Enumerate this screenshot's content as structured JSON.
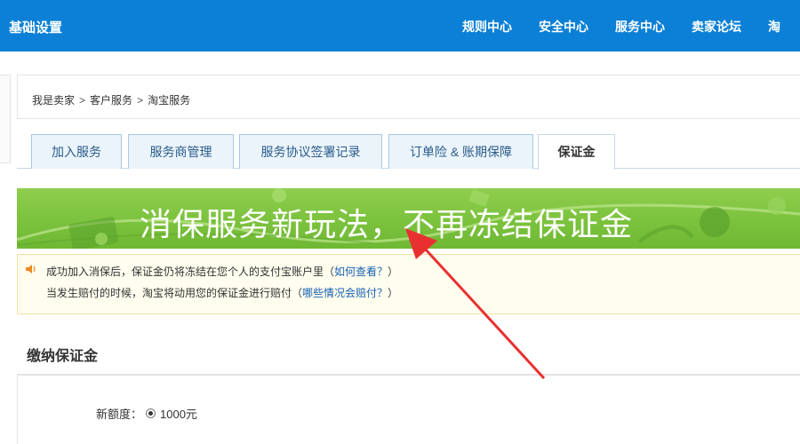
{
  "header": {
    "title": "基础设置",
    "nav": [
      "规则中心",
      "安全中心",
      "服务中心",
      "卖家论坛",
      "淘"
    ]
  },
  "breadcrumb": {
    "items": [
      "我是卖家",
      "客户服务",
      "淘宝服务"
    ],
    "separator": ">"
  },
  "tabs": [
    {
      "label": "加入服务",
      "active": false
    },
    {
      "label": "服务商管理",
      "active": false
    },
    {
      "label": "服务协议签署记录",
      "active": false
    },
    {
      "label": "订单险 & 账期保障",
      "active": false
    },
    {
      "label": "保证金",
      "active": true
    }
  ],
  "banner": {
    "text": "消保服务新玩法，不再冻结保证金"
  },
  "notice": {
    "icon": "speaker-icon",
    "line1_text": "成功加入消保后，保证金仍将冻结在您个人的支付宝账户里（",
    "line1_link": "如何查看？",
    "line1_end": "）",
    "line2_text": "当发生赔付的时候，淘宝将动用您的保证金进行赔付（",
    "line2_link": "哪些情况会赔付？",
    "line2_end": "）"
  },
  "section": {
    "title": "缴纳保证金",
    "field_label": "新额度：",
    "field_value": "1000元",
    "selected": true
  },
  "colors": {
    "topbar": "#0b80d6",
    "banner": "#7bc23d",
    "arrow": "#e83030",
    "link": "#1660b4"
  }
}
